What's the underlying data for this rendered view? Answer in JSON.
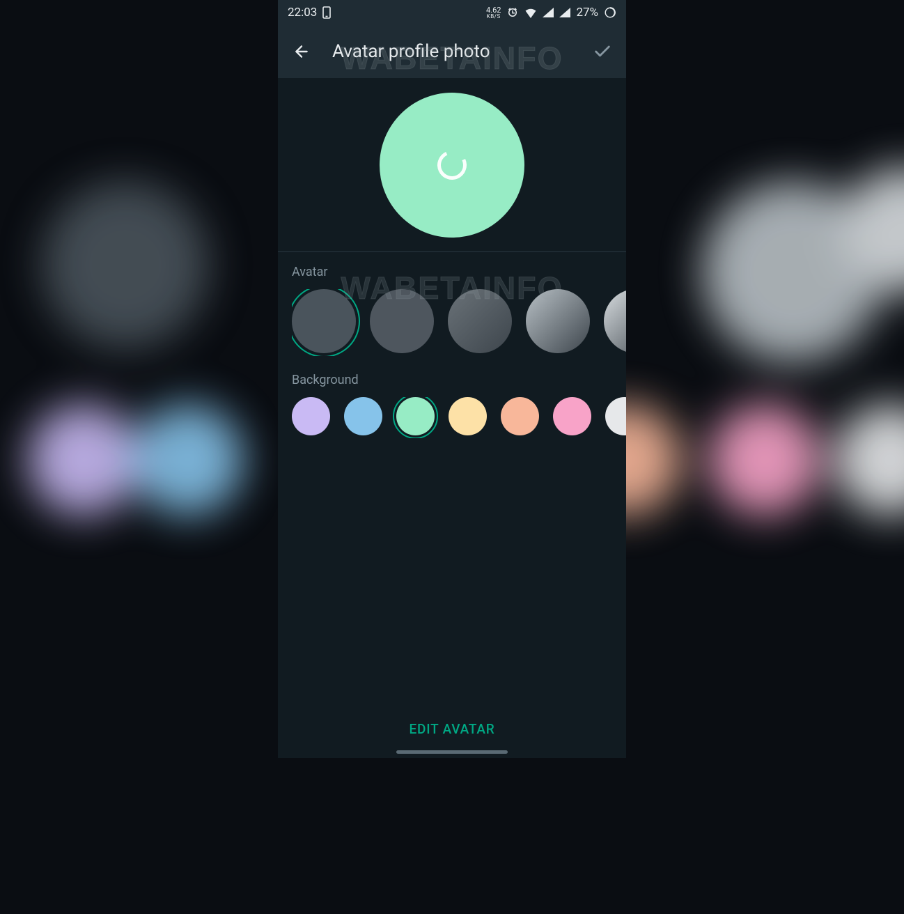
{
  "statusbar": {
    "time": "22:03",
    "net_speed": "4.62",
    "net_unit": "KB/S",
    "battery": "27%"
  },
  "header": {
    "title": "Avatar profile photo"
  },
  "watermark": "WABETAINFO",
  "sections": {
    "avatar_label": "Avatar",
    "background_label": "Background"
  },
  "preview": {
    "bg_color": "#97ecc5"
  },
  "avatar_options": [
    {
      "color": "#4a545c",
      "selected": true
    },
    {
      "color": "#4e565e",
      "selected": false
    },
    {
      "color": "#6a7278",
      "gradient": true,
      "selected": false
    },
    {
      "color": "#b8c0c5",
      "gradient": true,
      "selected": false
    },
    {
      "color": "#d8dde0",
      "gradient": true,
      "selected": false
    }
  ],
  "background_options": [
    {
      "color": "#c9baf4",
      "selected": false
    },
    {
      "color": "#86c3ea",
      "selected": false
    },
    {
      "color": "#97ecc5",
      "selected": true
    },
    {
      "color": "#fde1a7",
      "selected": false
    },
    {
      "color": "#f8b79a",
      "selected": false
    },
    {
      "color": "#f8a3c8",
      "selected": false
    },
    {
      "color": "#e6e8ea",
      "selected": false
    }
  ],
  "footer": {
    "edit_label": "EDIT AVATAR"
  },
  "accent": "#00a884"
}
